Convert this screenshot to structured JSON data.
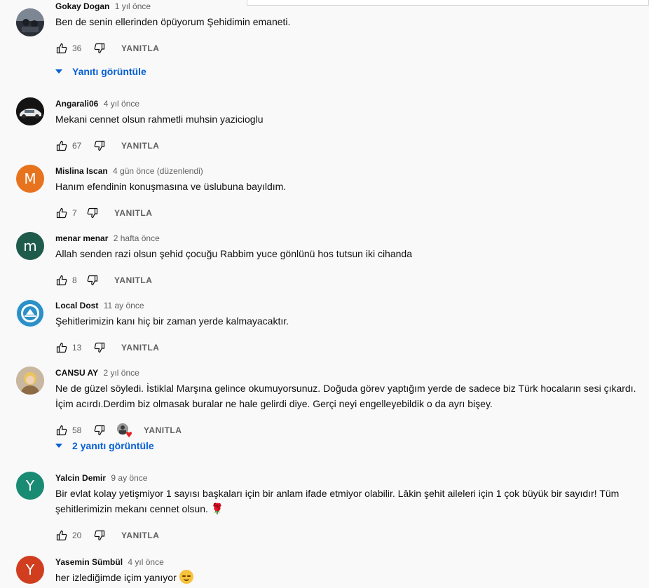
{
  "reply_label": "YANITLA",
  "colors": {
    "link": "#065fd4",
    "avatar_m": "#e8731f",
    "avatar_menar": "#1e5b4a",
    "avatar_y": "#1a8b73",
    "avatar_yasemin": "#d03e1f"
  },
  "comments": [
    {
      "author": "Gokay Dogan",
      "time": "1 yıl önce",
      "text": "Ben de senin ellerinden öpüyorum Şehidimin emaneti.",
      "likes": "36",
      "avatar_icon": "photo-avatar",
      "replies_label": "Yanıtı görüntüle"
    },
    {
      "author": "Angarali06",
      "time": "4 yıl önce",
      "text": "Mekani cennet olsun rahmetli muhsin yazicioglu",
      "likes": "67",
      "avatar_icon": "car-photo-avatar"
    },
    {
      "author": "Mislina Iscan",
      "time": "4 gün önce (düzenlendi)",
      "text": "Hanım efendinin konuşmasına ve üslubuna bayıldım.",
      "likes": "7",
      "avatar_letter": "M"
    },
    {
      "author": "menar menar",
      "time": "2 hafta önce",
      "text": "Allah senden razi olsun şehid çocuğu Rabbim yuce gönlünü hos tutsun iki cihanda",
      "likes": "8",
      "avatar_letter": "m"
    },
    {
      "author": "Local Dost",
      "time": "11 ay önce",
      "text": "Şehitlerimizin kanı hiç bir zaman yerde kalmayacaktır.",
      "likes": "13",
      "avatar_icon": "emblem-avatar"
    },
    {
      "author": "CANSU AY",
      "time": "2 yıl önce",
      "text": "Ne de güzel söyledi. İstiklal Marşına gelince okumuyorsunuz. Doğuda görev yaptığım yerde de sadece biz Türk hocaların sesi çıkardı. İçim acırdı.Derdim biz olmasak buralar ne hale gelirdi diye. Gerçi neyi engelleyebildik o da ayrı bişey.",
      "likes": "58",
      "avatar_icon": "person-photo-avatar",
      "replies_label": "2 yanıtı görüntüle"
    },
    {
      "author": "Yalcin Demir",
      "time": "9 ay önce",
      "text": "Bir evlat kolay yetişmiyor 1 sayısı başkaları için bir anlam ifade etmiyor olabilir. Lâkin şehit aileleri için 1 çok büyük bir sayıdır! Tüm şehitlerimizin mekanı cennet olsun.",
      "emoji": "🌹",
      "likes": "20",
      "avatar_letter": "Y"
    },
    {
      "author": "Yasemin Sümbül",
      "time": "4 yıl önce",
      "text": "her izlediğimde içim yanıyor",
      "avatar_letter": "Y"
    }
  ]
}
